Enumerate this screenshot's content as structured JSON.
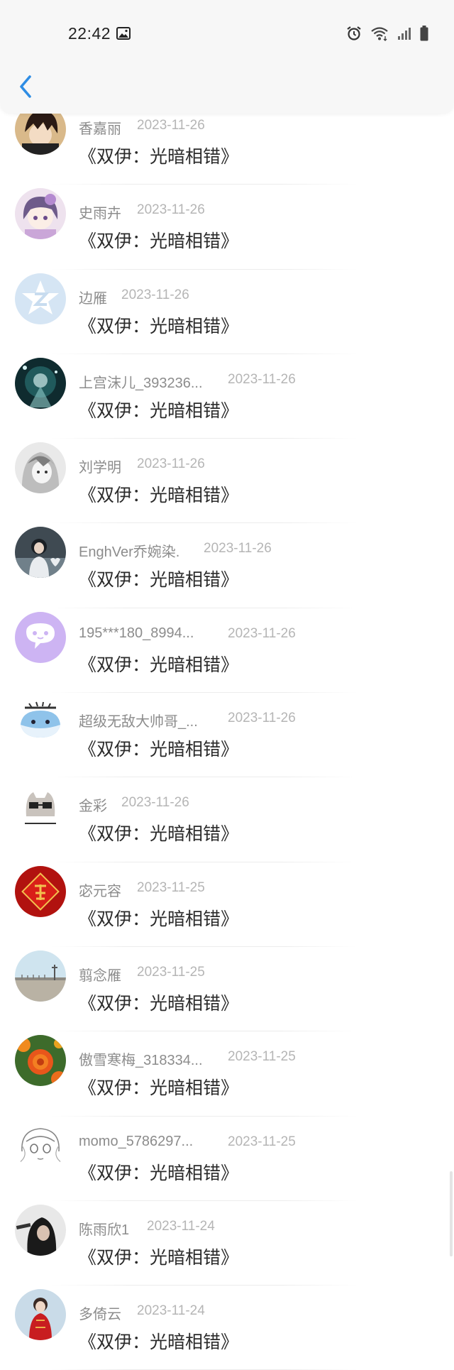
{
  "status_bar": {
    "time": "22:42",
    "icons": [
      "gallery-icon",
      "alarm-icon",
      "wifi-icon",
      "signal-icon",
      "battery-icon"
    ]
  },
  "nav": {
    "back_icon": "chevron-left-icon",
    "accent_color": "#2f8de4"
  },
  "list": [
    {
      "name": "香嘉丽",
      "date": "2023-11-26",
      "title": "《双伊：光暗相错》",
      "avatar": "anime-boy"
    },
    {
      "name": "史雨卉",
      "date": "2023-11-26",
      "title": "《双伊：光暗相错》",
      "avatar": "anime-girl-pink"
    },
    {
      "name": "边雁",
      "date": "2023-11-26",
      "title": "《双伊：光暗相错》",
      "avatar": "z-logo"
    },
    {
      "name": "上宫沫儿_393236...",
      "date": "2023-11-26",
      "title": "《双伊：光暗相错》",
      "avatar": "dark-teal"
    },
    {
      "name": "刘学明",
      "date": "2023-11-26",
      "title": "《双伊：光暗相错》",
      "avatar": "sketch-girl"
    },
    {
      "name": "EnghVer乔婉染.",
      "date": "2023-11-26",
      "title": "《双伊：光暗相错》",
      "avatar": "photo-girl"
    },
    {
      "name": "195***180_8994...",
      "date": "2023-11-26",
      "title": "《双伊：光暗相错》",
      "avatar": "chat-bubble"
    },
    {
      "name": "超级无敌大帅哥_...",
      "date": "2023-11-26",
      "title": "《双伊：光暗相错》",
      "avatar": "cartoon-whale"
    },
    {
      "name": "金彩",
      "date": "2023-11-26",
      "title": "《双伊：光暗相错》",
      "avatar": "cat-glasses"
    },
    {
      "name": "宓元容",
      "date": "2023-11-25",
      "title": "《双伊：光暗相错》",
      "avatar": "fu-red"
    },
    {
      "name": "翦念雁",
      "date": "2023-11-25",
      "title": "《双伊：光暗相错》",
      "avatar": "sky-landscape"
    },
    {
      "name": "傲雪寒梅_318334...",
      "date": "2023-11-25",
      "title": "《双伊：光暗相错》",
      "avatar": "orange-flowers"
    },
    {
      "name": "momo_5786297...",
      "date": "2023-11-25",
      "title": "《双伊：光暗相错》",
      "avatar": "line-art"
    },
    {
      "name": "陈雨欣1",
      "date": "2023-11-24",
      "title": "《双伊：光暗相错》",
      "avatar": "dark-portrait"
    },
    {
      "name": "多倚云",
      "date": "2023-11-24",
      "title": "《双伊：光暗相错》",
      "avatar": "red-dress"
    }
  ]
}
